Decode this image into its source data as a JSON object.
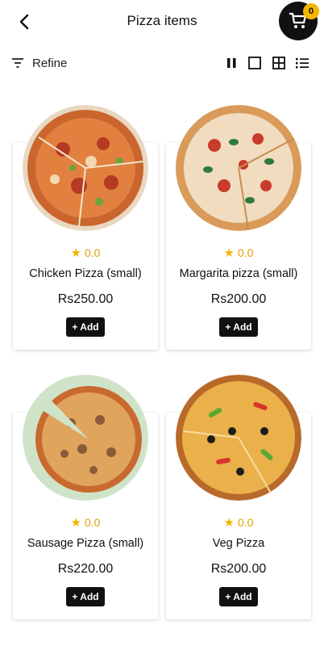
{
  "header": {
    "title": "Pizza items",
    "back_icon": "chevron-left-icon",
    "cart_icon": "shopping-cart-icon",
    "cart_count": "0"
  },
  "toolbar": {
    "refine_label": "Refine",
    "filter_icon": "filter-lines-icon",
    "views": [
      "pause-columns-icon",
      "single-square-icon",
      "grid-2x2-icon",
      "list-icon"
    ]
  },
  "products": [
    {
      "name": "Chicken Pizza (small)",
      "rating": "0.0",
      "price": "Rs250.00",
      "add_label": "+ Add",
      "image": "chicken-pizza"
    },
    {
      "name": "Margarita pizza (small)",
      "rating": "0.0",
      "price": "Rs200.00",
      "add_label": "+ Add",
      "image": "margarita-pizza"
    },
    {
      "name": "Sausage Pizza (small)",
      "rating": "0.0",
      "price": "Rs220.00",
      "add_label": "+ Add",
      "image": "sausage-pizza"
    },
    {
      "name": "Veg Pizza",
      "rating": "0.0",
      "price": "Rs200.00",
      "add_label": "+ Add",
      "image": "veg-pizza"
    }
  ],
  "colors": {
    "accent": "#f5b400",
    "button": "#111111"
  }
}
